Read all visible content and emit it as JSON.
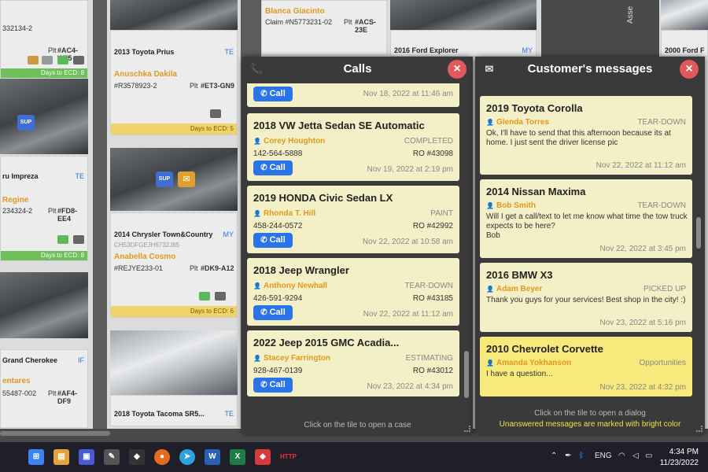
{
  "board": {
    "col1": {
      "tile_top": {
        "claim": "332134-2",
        "pos_label": "Plt",
        "pos": "#AC4-W55",
        "due": "Days to ECD: 8"
      },
      "tile_bottom": {
        "model": "ru Impreza",
        "pos_tag": "TE",
        "name": "Regine",
        "claim": "234324-2",
        "pos_label": "Plt",
        "pos": "#FD8-EE4",
        "due": "Days to ECD: 8"
      },
      "tile_last": {
        "model": "Grand Cherokee",
        "pos_tag": "IF",
        "name": "entares",
        "claim": "55487-002",
        "pos_label": "Plt",
        "pos": "#AF4-DF9"
      }
    },
    "col2": {
      "tile1": {
        "model": "2013 Toyota Prius",
        "pos_tag": "TE",
        "name": "Anuschka Dakila",
        "claim": "#R3578923-2",
        "pos_label": "Plt",
        "pos": "#ET3-GN9",
        "due": "Days to ECD: 5"
      },
      "tile2": {
        "model": "2014 Chrysler Town&Country",
        "pos_tag": "MY",
        "vin": "CH53DFGEJH6732J85",
        "name": "Anabella Cosmo",
        "claim": "#REJYE233-01",
        "pos_label": "Plt",
        "pos": "#DK9-A12",
        "due": "Days to ECD: 6"
      },
      "tile3": {
        "model": "2018 Toyota Tacoma SR5...",
        "pos_tag": "TE"
      }
    },
    "col3": {
      "tile1": {
        "name": "Blanca Giacinto",
        "claim": "Claim #N5773231-02",
        "pos_label": "Plt",
        "pos": "#ACS-23E"
      },
      "tile2": {
        "model": "2016 Ford Explorer",
        "pos_tag": "MY"
      }
    },
    "col4": {
      "tile1": {
        "model": "2000 Ford F"
      },
      "side_label": "Asse"
    }
  },
  "calls": {
    "title": "Calls",
    "close_label": "×",
    "call_label": "Call",
    "footer": "Click on the tile to open a case",
    "items": [
      {
        "title": "",
        "name": "",
        "status": "",
        "phone": "",
        "ro": "",
        "date": "Nov 18, 2022 at 11:46 am"
      },
      {
        "title": "2018 VW Jetta Sedan SE Automatic",
        "name": "Corey Houghton",
        "status": "COMPLETED",
        "phone": "142-564-5888",
        "ro": "RO #43098",
        "date": "Nov 19, 2022 at 2:19 pm"
      },
      {
        "title": "2019 HONDA Civic Sedan LX",
        "name": "Rhonda T. Hill",
        "status": "PAINT",
        "phone": "458-244-0572",
        "ro": "RO #42992",
        "date": "Nov 22, 2022 at 10:58 am"
      },
      {
        "title": "2018 Jeep Wrangler",
        "name": "Anthony Newhall",
        "status": "TEAR-DOWN",
        "phone": "426-591-9294",
        "ro": "RO #43185",
        "date": "Nov 22, 2022 at 11:12 am"
      },
      {
        "title": "2022 Jeep 2015 GMC Acadia...",
        "name": "Stacey Farrington",
        "status": "ESTIMATING",
        "phone": "928-467-0139",
        "ro": "RO #43012",
        "date": "Nov 23, 2022 at 4:34 pm"
      }
    ]
  },
  "messages": {
    "title": "Customer's messages",
    "close_label": "×",
    "footer_line1": "Click on the tile to open a dialog",
    "footer_line2": "Unanswered messages are marked with bright color",
    "items": [
      {
        "title": "2019 Toyota Corolla",
        "name": "Glenda Torres",
        "status": "TEAR-DOWN",
        "text": "Ok, I'll have to send that this afternoon because its at home. I just sent the driver license pic",
        "date": "Nov 22, 2022 at 11:12 am",
        "unread": false
      },
      {
        "title": "2014 Nissan Maxima",
        "name": "Bob Smith",
        "status": "TEAR-DOWN",
        "text": "Will I get a call/text to let me know what time the tow truck expects to be here?\nBob",
        "date": "Nov 22, 2022 at 3:45 pm",
        "unread": false
      },
      {
        "title": "2016 BMW X3",
        "name": "Adam Beyer",
        "status": "PICKED UP",
        "text": "Thank you guys for your services! Best shop in the city! :)",
        "date": "Nov 23, 2022 at 5:16 pm",
        "unread": false
      },
      {
        "title": "2010 Chevrolet Corvette",
        "name": "Amanda Yokhanson",
        "status": "Opportunities",
        "text": "I have a question...",
        "date": "Nov 23, 2022 at 4:32 pm",
        "unread": true
      }
    ]
  },
  "taskbar": {
    "language": "ENG",
    "time": "4:34 PM",
    "date": "11/23/2022"
  },
  "colors": {
    "accent_blue": "#2a73e8",
    "card_bg": "#f3efc6",
    "card_unread_bg": "#f7e97c",
    "close_red": "#e05a5a",
    "name_orange": "#e09a1b"
  }
}
